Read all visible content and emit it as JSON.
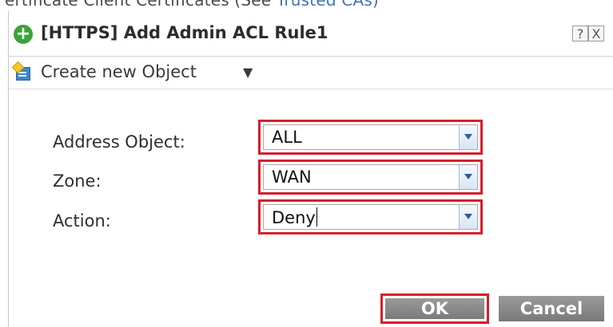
{
  "background": {
    "text": "ertificate Client Certificates",
    "see_text": "(See",
    "link_text": "Trusted CAs)"
  },
  "dialog": {
    "title": "[HTTPS] Add Admin ACL Rule1",
    "help_label": "?",
    "close_label": "X"
  },
  "toolbar": {
    "create_label": "Create new Object",
    "caret": "▼"
  },
  "form": {
    "address_object": {
      "label": "Address Object:",
      "value": "ALL"
    },
    "zone": {
      "label": "Zone:",
      "value": "WAN"
    },
    "action": {
      "label": "Action:",
      "value": "Deny"
    }
  },
  "buttons": {
    "ok": "OK",
    "cancel": "Cancel"
  },
  "colors": {
    "highlight": "#d51f2c",
    "add_icon": "#3aa33a",
    "button_gray": "#8a8a8a"
  }
}
